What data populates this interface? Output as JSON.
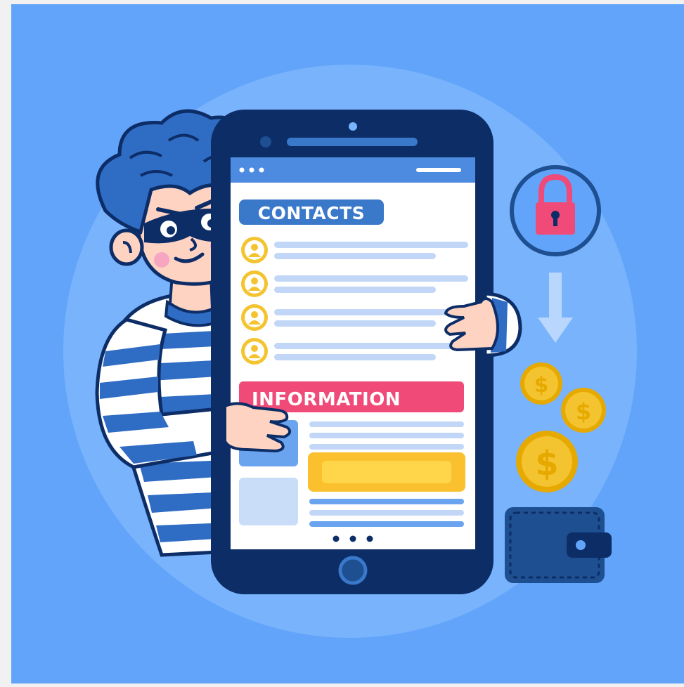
{
  "screen": {
    "contacts_title": "CONTACTS",
    "information_title": "INFORMATION",
    "contacts_count": 4,
    "pager_dots": 3
  },
  "colors": {
    "backdrop": "#63a4fb",
    "halo": "#78b3fc",
    "phone_body": "#0d2d67",
    "screen_bg": "#ffffff",
    "contacts_badge": "#3a78c9",
    "information_badge": "#ef4a78",
    "avatar_gold": "#f4c430",
    "line_light": "#c2d7f8",
    "line_blue": "#6aa4ef",
    "yellow_button": "#fbc02d",
    "lock_pink": "#ef4a78",
    "coin_gold": "#f4c430",
    "wallet": "#1d4f91",
    "thief_hair": "#2f6cc4",
    "thief_mask": "#0d2d67",
    "skin": "#ffd3c2",
    "stripe_blue": "#2f6cc4"
  },
  "icons": [
    "lock-icon",
    "down-arrow-icon",
    "dollar-coin-icon",
    "wallet-icon",
    "user-avatar-icon",
    "home-button-icon"
  ]
}
